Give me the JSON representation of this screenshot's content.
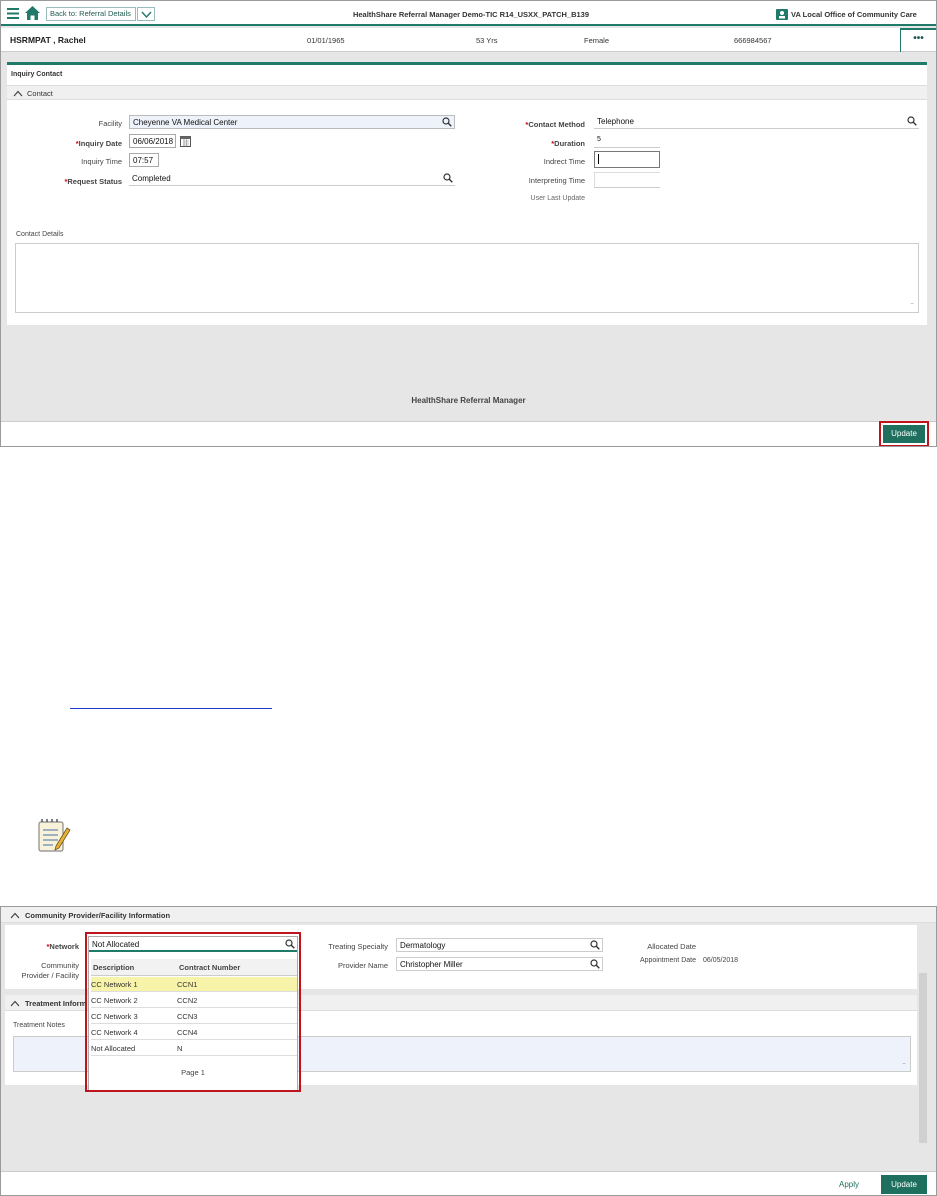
{
  "screen1": {
    "header": {
      "back_label": "Back to: Referral Details",
      "app_title": "HealthShare Referral Manager Demo-TIC R14_USXX_PATCH_B139",
      "office": "VA Local Office of Community Care"
    },
    "patient": {
      "name": "HSRMPAT , Rachel",
      "dob": "01/01/1965",
      "age": "53 Yrs",
      "sex": "Female",
      "id": "666984567",
      "more": "•••"
    },
    "page_title": "Inquiry Contact",
    "section_title": "Contact",
    "fields": {
      "facility_label": "Facility",
      "facility_value": "Cheyenne VA Medical Center",
      "inquiry_date_label": "Inquiry Date",
      "inquiry_date_value": "06/06/2018",
      "inquiry_time_label": "Inquiry Time",
      "inquiry_time_value": "07:57",
      "request_status_label": "Request Status",
      "request_status_value": "Completed",
      "contact_method_label": "Contact Method",
      "contact_method_value": "Telephone",
      "duration_label": "Duration",
      "duration_value": "5",
      "indirect_time_label": "Indrect Time",
      "indirect_time_value": "",
      "interpreting_time_label": "Interpreting Time",
      "interpreting_time_value": "",
      "user_last_update_label": "User Last Update"
    },
    "contact_details_label": "Contact Details",
    "footer_text": "HealthShare Referral Manager",
    "update_label": "Update"
  },
  "screen2": {
    "section_title": "Community Provider/Facility Information",
    "network_label": "Network",
    "network_value": "Not Allocated",
    "community_label_1": "Community",
    "community_label_2": "Provider / Facility",
    "treating_specialty_label": "Treating Specialty",
    "treating_specialty_value": "Dermatology",
    "provider_name_label": "Provider Name",
    "provider_name_value": "Christopher Miller",
    "allocated_date_label": "Allocated Date",
    "appointment_date_label": "Appointment Date",
    "appointment_date_value": "06/05/2018",
    "treatment_section_title": "Treatment Inform",
    "treatment_notes_label": "Treatment Notes",
    "dropdown": {
      "col_description": "Description",
      "col_contract": "Contract Number",
      "rows": [
        {
          "description": "CC Network 1",
          "contract": "CCN1"
        },
        {
          "description": "CC Network 2",
          "contract": "CCN2"
        },
        {
          "description": "CC Network 3",
          "contract": "CCN3"
        },
        {
          "description": "CC Network 4",
          "contract": "CCN4"
        },
        {
          "description": "Not Allocated",
          "contract": "N"
        }
      ],
      "page_label": "Page 1"
    },
    "apply_label": "Apply",
    "update_label": "Update"
  },
  "colors": {
    "teal": "#1f7a6a",
    "button": "#1f6f5e",
    "highlight_red": "#c0141c",
    "selected_row": "#f7f3a8"
  }
}
